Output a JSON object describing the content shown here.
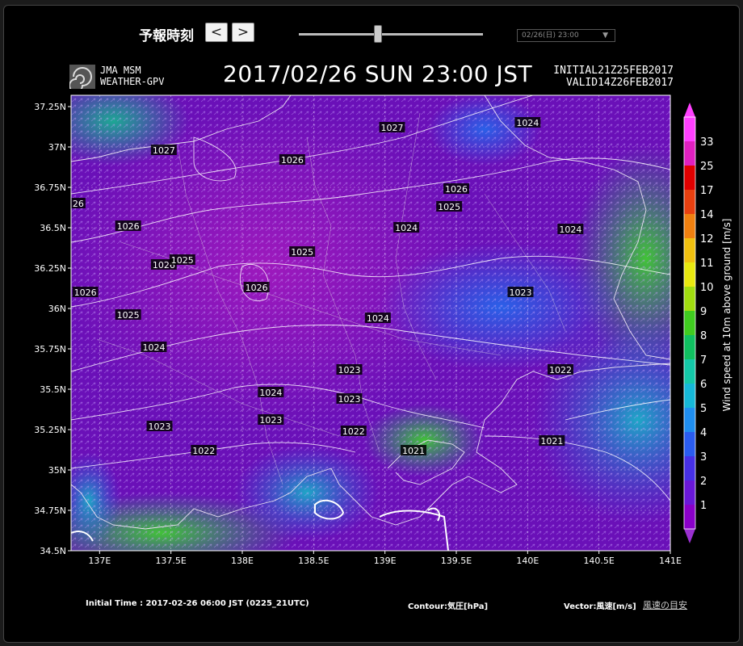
{
  "controls": {
    "forecast_time_label": "予報時刻",
    "prev_button": "<",
    "next_button": ">",
    "time_select_value": "02/26(日) 23:00",
    "time_slider_fraction": 0.43
  },
  "header": {
    "logo_line1": "JMA MSM",
    "logo_line2": "WEATHER-GPV",
    "valid_datetime": "2017/02/26 SUN 23:00 JST",
    "initial": "INITIAL21Z25FEB2017",
    "valid": "VALID14Z26FEB2017"
  },
  "map": {
    "lat_labels": [
      "37.25N",
      "37N",
      "36.75N",
      "36.5N",
      "36.25N",
      "36N",
      "35.75N",
      "35.5N",
      "35.25N",
      "35N",
      "34.75N",
      "34.5N"
    ],
    "lon_labels": [
      "137E",
      "137.5E",
      "138E",
      "138.5E",
      "139E",
      "139.5E",
      "140E",
      "140.5E",
      "141E"
    ],
    "pressure_labels": [
      {
        "text": "1027",
        "lon": 139.05,
        "lat": 37.12
      },
      {
        "text": "1024",
        "lon": 140.0,
        "lat": 37.15
      },
      {
        "text": "1027",
        "lon": 137.45,
        "lat": 36.98
      },
      {
        "text": "1026",
        "lon": 138.35,
        "lat": 36.92
      },
      {
        "text": "1026",
        "lon": 139.5,
        "lat": 36.74
      },
      {
        "text": "1025",
        "lon": 139.45,
        "lat": 36.63
      },
      {
        "text": "26",
        "lon": 136.85,
        "lat": 36.65
      },
      {
        "text": "1026",
        "lon": 137.2,
        "lat": 36.51
      },
      {
        "text": "1024",
        "lon": 139.15,
        "lat": 36.5
      },
      {
        "text": "1024",
        "lon": 140.3,
        "lat": 36.49
      },
      {
        "text": "1025",
        "lon": 138.42,
        "lat": 36.35
      },
      {
        "text": "1026",
        "lon": 137.45,
        "lat": 36.27
      },
      {
        "text": "1025",
        "lon": 137.58,
        "lat": 36.3
      },
      {
        "text": "1026",
        "lon": 136.9,
        "lat": 36.1
      },
      {
        "text": "1026",
        "lon": 138.1,
        "lat": 36.13
      },
      {
        "text": "1023",
        "lon": 139.95,
        "lat": 36.1
      },
      {
        "text": "1025",
        "lon": 137.2,
        "lat": 35.96
      },
      {
        "text": "1024",
        "lon": 138.95,
        "lat": 35.94
      },
      {
        "text": "1024",
        "lon": 137.38,
        "lat": 35.76
      },
      {
        "text": "1023",
        "lon": 138.75,
        "lat": 35.62
      },
      {
        "text": "1022",
        "lon": 140.23,
        "lat": 35.62
      },
      {
        "text": "1024",
        "lon": 138.2,
        "lat": 35.48
      },
      {
        "text": "1023",
        "lon": 138.75,
        "lat": 35.44
      },
      {
        "text": "1023",
        "lon": 137.42,
        "lat": 35.27
      },
      {
        "text": "1023",
        "lon": 138.2,
        "lat": 35.31
      },
      {
        "text": "1022",
        "lon": 138.78,
        "lat": 35.24
      },
      {
        "text": "1021",
        "lon": 140.17,
        "lat": 35.18
      },
      {
        "text": "1022",
        "lon": 137.73,
        "lat": 35.12
      },
      {
        "text": "1021",
        "lon": 139.2,
        "lat": 35.12
      }
    ]
  },
  "colorbar": {
    "label": "Wind speed at 10m above ground [m/s]",
    "levels": [
      "1",
      "2",
      "3",
      "4",
      "5",
      "6",
      "7",
      "8",
      "9",
      "10",
      "11",
      "12",
      "14",
      "17",
      "25",
      "33"
    ],
    "colors": [
      "#8a00c8",
      "#6a18d8",
      "#4630e6",
      "#2a5cf0",
      "#1f8ef0",
      "#16b8d8",
      "#14c8a8",
      "#10c060",
      "#40cc20",
      "#a0dc10",
      "#e8e810",
      "#f0c010",
      "#f08010",
      "#e84010",
      "#e00000",
      "#e020c0",
      "#ff40ff"
    ]
  },
  "footer": {
    "initial_time": "Initial Time : 2017-02-26 06:00 JST (0225_21UTC)",
    "contour": "Contour:気圧[hPa]",
    "vector": "Vector:風速[m/s]",
    "guide_link": "風速の目安"
  }
}
